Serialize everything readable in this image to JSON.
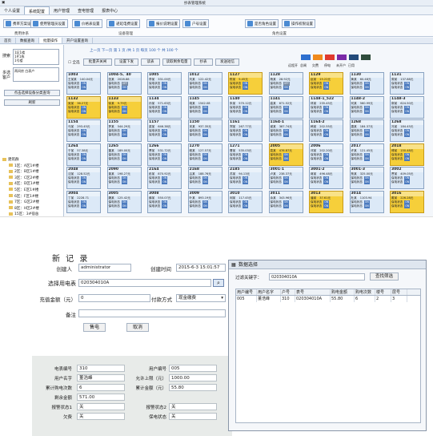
{
  "app": {
    "window_title": "抄表管理系统",
    "menus": [
      "个人设置",
      "系统配置",
      "用户管理",
      "查电管理",
      "报表中心"
    ],
    "active_menu": 1
  },
  "ribbon": {
    "buttons": [
      "费率方案设置",
      "使用管理员设置",
      "价格表设置",
      "递延电费设置",
      "报价说明设置",
      "户号设置",
      "是否角色设置",
      "操作权限设置"
    ],
    "groups": [
      "费用体系",
      "设备管理",
      "角色设置"
    ]
  },
  "tabs": [
    "首页",
    "数据查询",
    "批量操作",
    "开户设置查询"
  ],
  "left": {
    "search_label": "搜索",
    "search_value": "1区1楼\n1#1栋\n1号楼",
    "multi_label": "多选客户",
    "multi_value": "两间房 白表户",
    "btn_query": "点击选择设备分类查询",
    "btn_refresh": "刷新",
    "tree_root": "建筑群",
    "tree_items": [
      "1区：A区1#楼",
      "2区：B区1#楼",
      "3区：C区2#楼",
      "4区：D区1#楼",
      "5区：E区1#楼",
      "6区：F区1#楼",
      "7区：G区2#楼",
      "8区：H区2#楼",
      "15区：3#宿舍",
      "19区：3#宿舍"
    ]
  },
  "main": {
    "pager": "上一页  下一页  第 1 页 /共 1 页  每页 100 个  共 100 个",
    "check_all": "全选",
    "buttons": [
      "批量开关闸",
      "设置下发",
      "读表",
      "读取剩余电量",
      "抄表",
      "发送短信"
    ],
    "legend_labels": [
      "远程开",
      "总闸",
      "欠费",
      "停电",
      "未开户",
      "已用"
    ],
    "legend_colors": [
      "#2d6fcf",
      "#f08a1c",
      "#e03a2e",
      "#7a2aa8",
      "#234a7a",
      "#2f4c3c"
    ],
    "card_status_label": "保电状态",
    "card_on": "ON",
    "card_off": "OFF"
  },
  "cards": [
    {
      "id": "1003",
      "name": "王某某",
      "val": "140.04元",
      "y": false,
      "sw": "ON"
    },
    {
      "id": "1004-5、40",
      "name": "张某",
      "val": "2028.88",
      "y": false,
      "sw": "OFF"
    },
    {
      "id": "1005",
      "name": "李某",
      "val": "331.00元",
      "y": false,
      "sw": "ON"
    },
    {
      "id": "1012",
      "name": "刘某",
      "val": "122.42元",
      "y": false,
      "sw": "ON"
    },
    {
      "id": "1127",
      "name": "陈某",
      "val": "5.45元",
      "y": true,
      "sw": "ON"
    },
    {
      "id": "1128",
      "name": "杨某",
      "val": "28.92元",
      "y": false,
      "sw": "OFF"
    },
    {
      "id": "1129",
      "name": "赵某",
      "val": "15.22元",
      "y": true,
      "sw": "ON"
    },
    {
      "id": "1130",
      "name": "黄某",
      "val": "60.48元",
      "y": false,
      "sw": "ON"
    },
    {
      "id": "1131",
      "name": "周某",
      "val": "137.88元",
      "y": false,
      "sw": "ON"
    },
    {
      "id": "1132",
      "name": "吴某",
      "val": "36.27元",
      "y": true,
      "sw": "ON"
    },
    {
      "id": "1133",
      "name": "徐某",
      "val": "9.79元",
      "y": true,
      "sw": "ON"
    },
    {
      "id": "1134",
      "name": "孙某",
      "val": "571.63元",
      "y": false,
      "sw": "ON"
    },
    {
      "id": "1145",
      "name": "胡某",
      "val": "1542.08",
      "y": false,
      "sw": "ON"
    },
    {
      "id": "1140",
      "name": "朱某",
      "val": "570.12元",
      "y": false,
      "sw": "ON"
    },
    {
      "id": "1141",
      "name": "高某",
      "val": "671.52元",
      "y": false,
      "sw": "ON"
    },
    {
      "id": "1148-1_522",
      "name": "林某",
      "val": "235.45元",
      "y": false,
      "sw": "ON"
    },
    {
      "id": "1148-2",
      "name": "何某",
      "val": "560.99元",
      "y": false,
      "sw": "ON"
    },
    {
      "id": "1148-3",
      "name": "郭某",
      "val": "624.50元",
      "y": false,
      "sw": "ON"
    },
    {
      "id": "1154",
      "name": "马某",
      "val": "293.45元",
      "y": false,
      "sw": "ON"
    },
    {
      "id": "1155",
      "name": "罗某",
      "val": "544.29元",
      "y": false,
      "sw": "ON"
    },
    {
      "id": "1157",
      "name": "梁某",
      "val": "646.38元",
      "y": false,
      "sw": "ON"
    },
    {
      "id": "1150",
      "name": "宋某",
      "val": "937.35元",
      "y": false,
      "sw": "ON"
    },
    {
      "id": "1161",
      "name": "郑某",
      "val": "267.77元",
      "y": false,
      "sw": "ON"
    },
    {
      "id": "1164-1",
      "name": "谢某",
      "val": "387.74元",
      "y": false,
      "sw": "ON"
    },
    {
      "id": "1164-2",
      "name": "韩某",
      "val": "202.55元",
      "y": false,
      "sw": "ON"
    },
    {
      "id": "1268",
      "name": "唐某",
      "val": "184.37元",
      "y": false,
      "sw": "ON"
    },
    {
      "id": "1268",
      "name": "冯某",
      "val": "184.45元",
      "y": false,
      "sw": "ON"
    },
    {
      "id": "1264",
      "name": "于某",
      "val": "57.38元",
      "y": false,
      "sw": "ON"
    },
    {
      "id": "1265",
      "name": "董某",
      "val": "189.00元",
      "y": false,
      "sw": "ON"
    },
    {
      "id": "1266",
      "name": "萧某",
      "val": "531.72元",
      "y": false,
      "sw": "ON"
    },
    {
      "id": "1270",
      "name": "程某",
      "val": "127.57元",
      "y": false,
      "sw": "ON"
    },
    {
      "id": "1271",
      "name": "曹某",
      "val": "535.03元",
      "y": false,
      "sw": "ON"
    },
    {
      "id": "2005",
      "name": "袁某",
      "val": "476.87元",
      "y": true,
      "sw": "ON"
    },
    {
      "id": "2006",
      "name": "邓某",
      "val": "202.20元",
      "y": false,
      "sw": "ON"
    },
    {
      "id": "2017",
      "name": "许某",
      "val": "121.45元",
      "y": false,
      "sw": "ON"
    },
    {
      "id": "2018",
      "name": "傅某",
      "val": "150.48元",
      "y": true,
      "sw": "ON"
    },
    {
      "id": "2048",
      "name": "沈某",
      "val": "128.52元",
      "y": false,
      "sw": "ON"
    },
    {
      "id": "2090",
      "name": "曾某",
      "val": "198.27元",
      "y": false,
      "sw": "ON"
    },
    {
      "id": "2164",
      "name": "彭某",
      "val": "870.92元",
      "y": false,
      "sw": "ON"
    },
    {
      "id": "2168",
      "name": "吕某",
      "val": "188.76元",
      "y": false,
      "sw": "ON"
    },
    {
      "id": "2185",
      "name": "苏某",
      "val": "94.13元",
      "y": false,
      "sw": "ON"
    },
    {
      "id": "3001-1",
      "name": "卢某",
      "val": "238.37元",
      "y": false,
      "sw": "ON"
    },
    {
      "id": "3001-2",
      "name": "蒋某",
      "val": "496.48元",
      "y": false,
      "sw": "ON"
    },
    {
      "id": "3001-3",
      "name": "蔡某",
      "val": "325.00元",
      "y": false,
      "sw": "ON"
    },
    {
      "id": "3002",
      "name": "贾某",
      "val": "409.05元",
      "y": false,
      "sw": "ON"
    },
    {
      "id": "3004",
      "name": "丁某",
      "val": "2228.71",
      "y": false,
      "sw": "ON"
    },
    {
      "id": "3005",
      "name": "魏某",
      "val": "125.42元",
      "y": false,
      "sw": "ON"
    },
    {
      "id": "3008",
      "name": "薛某",
      "val": "550.07元",
      "y": false,
      "sw": "ON"
    },
    {
      "id": "3009",
      "name": "叶某",
      "val": "893.19元",
      "y": false,
      "sw": "ON"
    },
    {
      "id": "3010",
      "name": "阎某",
      "val": "117.45元",
      "y": false,
      "sw": "ON"
    },
    {
      "id": "3011",
      "name": "余某",
      "val": "343.96元",
      "y": false,
      "sw": "ON"
    },
    {
      "id": "3013",
      "name": "潘某",
      "val": "37.61元",
      "y": true,
      "sw": "ON"
    },
    {
      "id": "3014",
      "name": "杜某",
      "val": "1103.94",
      "y": false,
      "sw": "ON"
    },
    {
      "id": "3016",
      "name": "戴某",
      "val": "226.28元",
      "y": true,
      "sw": "ON"
    }
  ],
  "form": {
    "title": "新 记 录",
    "creator_label": "创建人",
    "creator_value": "administrator",
    "ctime_label": "创建时间",
    "ctime_value": "2015-6-3 15:01:57",
    "meter_label": "选择用电表",
    "meter_value": "020304010A",
    "amount_label": "充值金额（元）",
    "amount_value": "0",
    "pay_label": "付款方式",
    "pay_value": "现金缴费",
    "remark_label": "备注",
    "sell_button": "售电",
    "cancel_button": "取消"
  },
  "stats": {
    "meter_no_label": "电表编号",
    "meter_no": "310",
    "user_no_label": "用户编号",
    "user_no": "005",
    "user_name_label": "用户名字",
    "user_name": "董浩峰",
    "limit_label": "允许上限（元）",
    "limit": "1000.00",
    "total_buy_label": "累计购电次数",
    "total_buy": "6",
    "total_amount_label": "累计金额（元）",
    "total_amount": "55.80",
    "remain_label": "剩余金额",
    "remain": "571.00",
    "alarm1_label": "报警状态1",
    "alarm1": "关",
    "alarm2_label": "报警状态2",
    "alarm2": "关",
    "owe_label": "欠费",
    "owe": "关",
    "protect_label": "保电状态",
    "protect": "关"
  },
  "dialog": {
    "title": "数据选择",
    "filter_label": "过滤关键字：",
    "filter_value": "020304010A",
    "filter_button": "查找筛选",
    "columns": [
      "用户编号",
      "用户名字",
      "户号",
      "表号",
      "购电金额",
      "购电次数",
      "楼号",
      "层号"
    ],
    "rows": [
      [
        "005",
        "董浩峰",
        "310",
        "020304010A",
        "55.80",
        "6",
        "2",
        "3"
      ]
    ]
  }
}
